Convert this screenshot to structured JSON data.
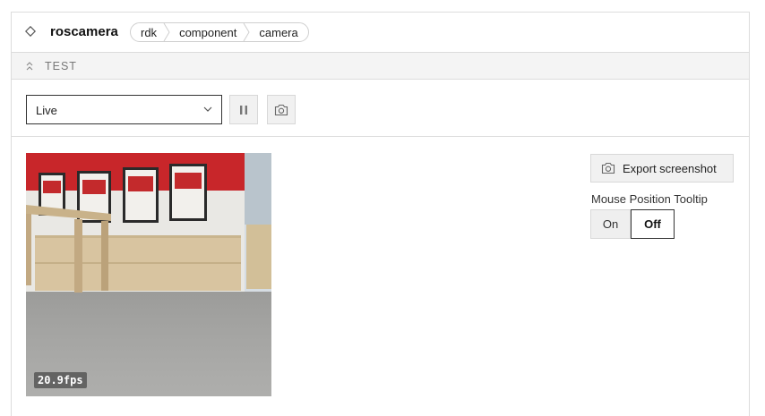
{
  "header": {
    "title": "roscamera",
    "breadcrumbs": [
      "rdk",
      "component",
      "camera"
    ]
  },
  "section": {
    "label": "TEST"
  },
  "controls": {
    "stream_mode": "Live",
    "pause_icon": "pause-icon",
    "snapshot_icon": "camera-icon"
  },
  "stream": {
    "fps": "20.9fps"
  },
  "sidebar": {
    "export_label": "Export screenshot",
    "tooltip_label": "Mouse Position Tooltip",
    "toggle_on": "On",
    "toggle_off": "Off",
    "selected": "Off"
  },
  "colors": {
    "border": "#dcdcdc",
    "section_bg": "#f4f4f4",
    "button_bg": "#f1f1f1",
    "wall_red": "#c8262a"
  }
}
